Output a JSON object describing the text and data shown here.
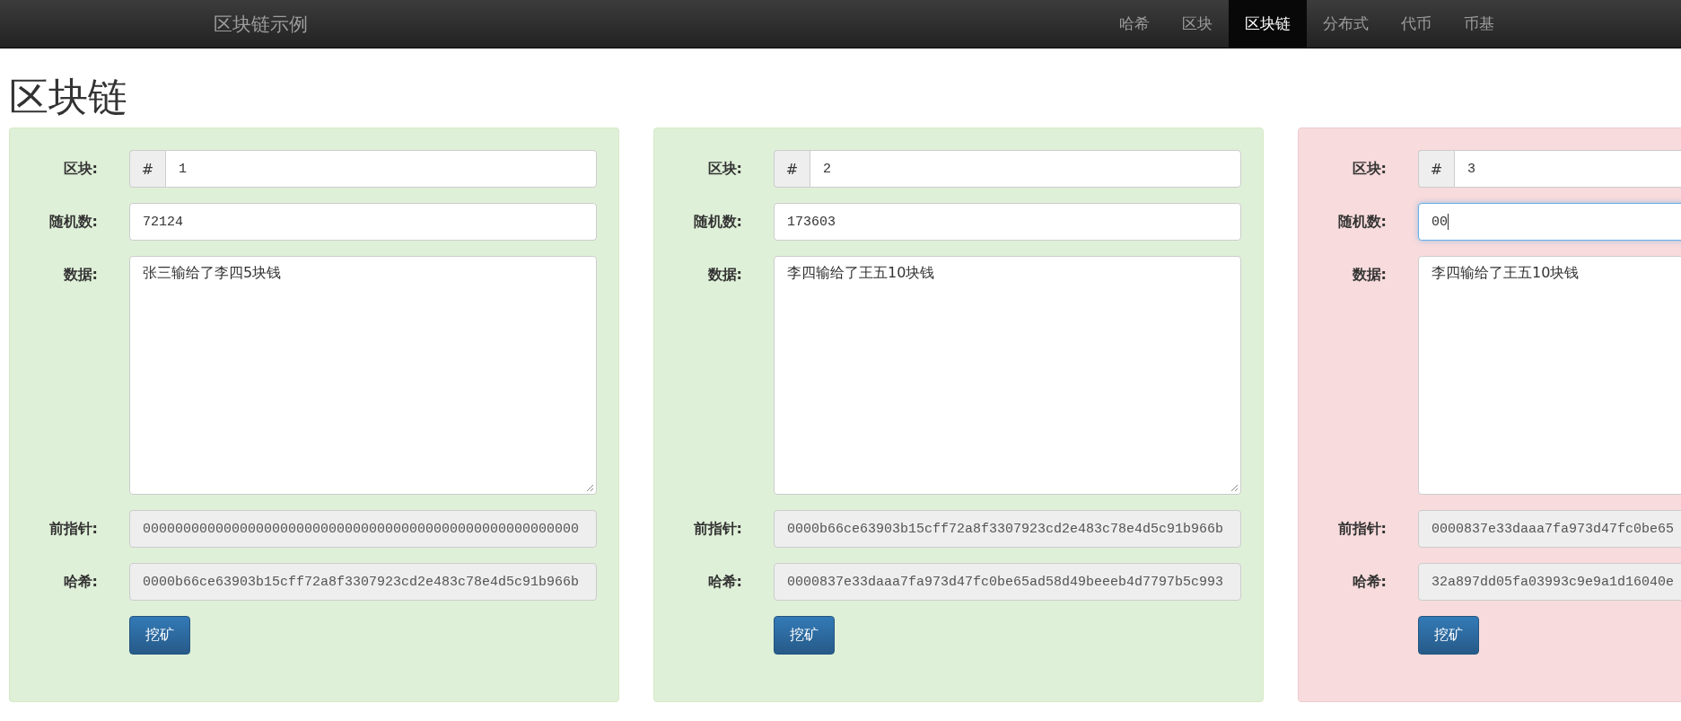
{
  "navbar": {
    "brand": "区块链示例",
    "items": [
      {
        "label": "哈希",
        "selected": false
      },
      {
        "label": "区块",
        "selected": false
      },
      {
        "label": "区块链",
        "selected": true
      },
      {
        "label": "分布式",
        "selected": false
      },
      {
        "label": "代币",
        "selected": false
      },
      {
        "label": "币基",
        "selected": false
      }
    ]
  },
  "title": "区块链",
  "blocks": [
    {
      "valid": true,
      "block_label": "区块:",
      "block_prefix": "#",
      "block": "1",
      "nonce_label": "随机数:",
      "nonce": "72124",
      "nonce_focused": false,
      "data_label": "数据:",
      "data": "张三输给了李四5块钱",
      "prev_label": "前指针:",
      "prev": "000000000000000000000000000000000000000000000000000000",
      "hash_label": "哈希:",
      "hash": "0000b66ce63903b15cff72a8f3307923cd2e483c78e4d5c91b966b",
      "button": "挖矿"
    },
    {
      "valid": true,
      "block_label": "区块:",
      "block_prefix": "#",
      "block": "2",
      "nonce_label": "随机数:",
      "nonce": "173603",
      "nonce_focused": false,
      "data_label": "数据:",
      "data": "李四输给了王五10块钱",
      "prev_label": "前指针:",
      "prev": "0000b66ce63903b15cff72a8f3307923cd2e483c78e4d5c91b966b",
      "hash_label": "哈希:",
      "hash": "0000837e33daaa7fa973d47fc0be65ad58d49beeeb4d7797b5c993",
      "button": "挖矿"
    },
    {
      "valid": false,
      "block_label": "区块:",
      "block_prefix": "#",
      "block": "3",
      "nonce_label": "随机数:",
      "nonce": "00",
      "nonce_focused": true,
      "data_label": "数据:",
      "data": "李四输给了王五10块钱",
      "prev_label": "前指针:",
      "prev": "0000837e33daaa7fa973d47fc0be65",
      "hash_label": "哈希:",
      "hash": "32a897dd05fa03993c9e9a1d16040e",
      "button": "挖矿"
    }
  ]
}
